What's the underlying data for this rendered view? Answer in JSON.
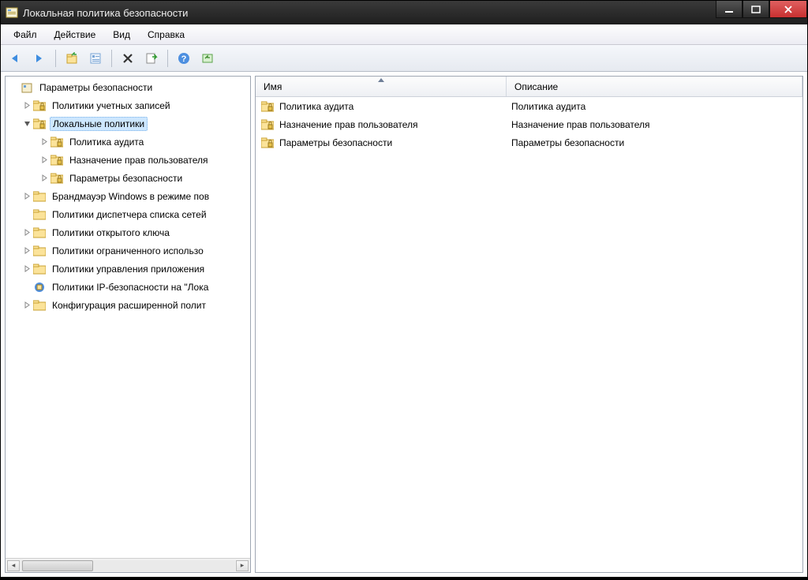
{
  "window": {
    "title": "Локальная политика безопасности"
  },
  "menu": {
    "file": "Файл",
    "action": "Действие",
    "view": "Вид",
    "help": "Справка"
  },
  "tree": {
    "root": "Параметры безопасности",
    "items": [
      {
        "label": "Политики учетных записей",
        "icon": "folder-lock"
      },
      {
        "label": "Локальные политики",
        "icon": "folder-lock",
        "selected": true,
        "expanded": true,
        "children": [
          {
            "label": "Политика аудита",
            "icon": "folder-lock"
          },
          {
            "label": "Назначение прав пользователя",
            "icon": "folder-lock"
          },
          {
            "label": "Параметры безопасности",
            "icon": "folder-lock"
          }
        ]
      },
      {
        "label": "Брандмауэр Windows в режиме пов",
        "icon": "folder"
      },
      {
        "label": "Политики диспетчера списка сетей",
        "icon": "folder"
      },
      {
        "label": "Политики открытого ключа",
        "icon": "folder"
      },
      {
        "label": "Политики ограниченного использо",
        "icon": "folder"
      },
      {
        "label": "Политики управления приложения",
        "icon": "folder"
      },
      {
        "label": "Политики IP-безопасности на \"Лока",
        "icon": "ipsec"
      },
      {
        "label": "Конфигурация расширенной полит",
        "icon": "folder"
      }
    ]
  },
  "list": {
    "columns": {
      "name": "Имя",
      "desc": "Описание"
    },
    "rows": [
      {
        "name": "Политика аудита",
        "desc": "Политика аудита"
      },
      {
        "name": "Назначение прав пользователя",
        "desc": "Назначение прав пользователя"
      },
      {
        "name": "Параметры безопасности",
        "desc": "Параметры безопасности"
      }
    ]
  }
}
